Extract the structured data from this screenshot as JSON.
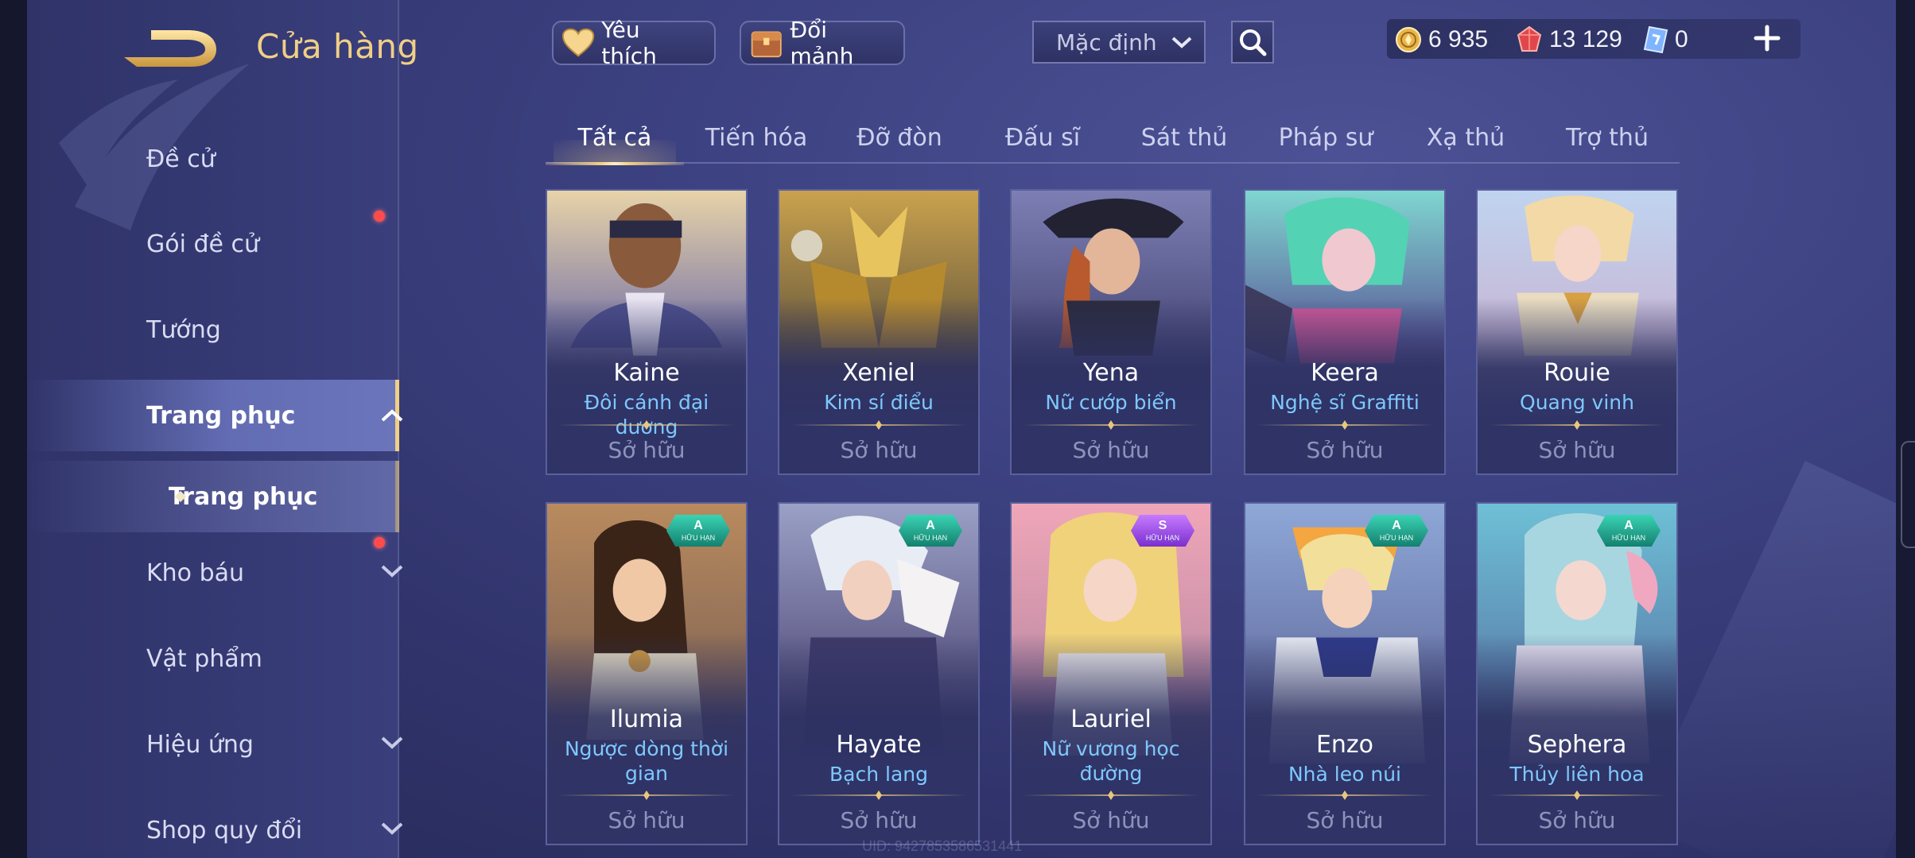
{
  "header": {
    "title": "Cửa hàng",
    "favorite_label": "Yêu thích",
    "exchange_label": "Đổi mảnh",
    "sort_value": "Mặc định"
  },
  "currency": {
    "gold": "6 935",
    "vouchers": "13 129",
    "tickets": "0"
  },
  "sidebar": {
    "items": [
      {
        "label": "Đề cử"
      },
      {
        "label": "Gói đề cử"
      },
      {
        "label": "Tướng"
      },
      {
        "label": "Trang phục"
      },
      {
        "label": "Trang phục"
      },
      {
        "label": "Kho báu"
      },
      {
        "label": "Vật phẩm"
      },
      {
        "label": "Hiệu ứng"
      },
      {
        "label": "Shop quy đổi"
      }
    ]
  },
  "tabs": [
    "Tất cả",
    "Tiến hóa",
    "Đỡ đòn",
    "Đấu sĩ",
    "Sát thủ",
    "Pháp sư",
    "Xạ thủ",
    "Trợ thủ"
  ],
  "cards": [
    {
      "hero": "Kaine",
      "skin": "Đôi cánh đại dương",
      "status": "Sở hữu"
    },
    {
      "hero": "Xeniel",
      "skin": "Kim sí điểu",
      "status": "Sở hữu"
    },
    {
      "hero": "Yena",
      "skin": "Nữ cướp biển",
      "status": "Sở hữu"
    },
    {
      "hero": "Keera",
      "skin": "Nghệ sĩ Graffiti",
      "status": "Sở hữu"
    },
    {
      "hero": "Rouie",
      "skin": "Quang vinh",
      "status": "Sở hữu"
    },
    {
      "hero": "Ilumia",
      "skin": "Ngược dòng thời gian",
      "status": "Sở hữu",
      "rank": "A",
      "rank_label": "HỮU HẠN"
    },
    {
      "hero": "Hayate",
      "skin": "Bạch lang",
      "status": "Sở hữu",
      "rank": "A",
      "rank_label": "HỮU HẠN"
    },
    {
      "hero": "Lauriel",
      "skin": "Nữ vương học đường",
      "status": "Sở hữu",
      "rank": "S",
      "rank_label": "HỮU HẠN"
    },
    {
      "hero": "Enzo",
      "skin": "Nhà leo núi",
      "status": "Sở hữu",
      "rank": "A",
      "rank_label": "HỮU HẠN"
    },
    {
      "hero": "Sephera",
      "skin": "Thủy liên hoa",
      "status": "Sở hữu",
      "rank": "A",
      "rank_label": "HỮU HẠN"
    }
  ],
  "footer": {
    "uid": "UID: 9427853586531441"
  },
  "icons": {
    "back": "back-arrow-icon",
    "favorite": "heart-icon",
    "exchange": "shard-chest-icon",
    "search": "magnifier-icon",
    "gold": "gold-coin-icon",
    "vouchers": "ruby-icon",
    "tickets": "ticket-icon",
    "plus": "plus-icon"
  },
  "colors": {
    "accent_gold": "#f0cf86",
    "skin_name": "#7ec8ff",
    "notification": "#ff4b4b",
    "rank_a": "#1fa88f",
    "rank_s": "#9a44e6"
  }
}
